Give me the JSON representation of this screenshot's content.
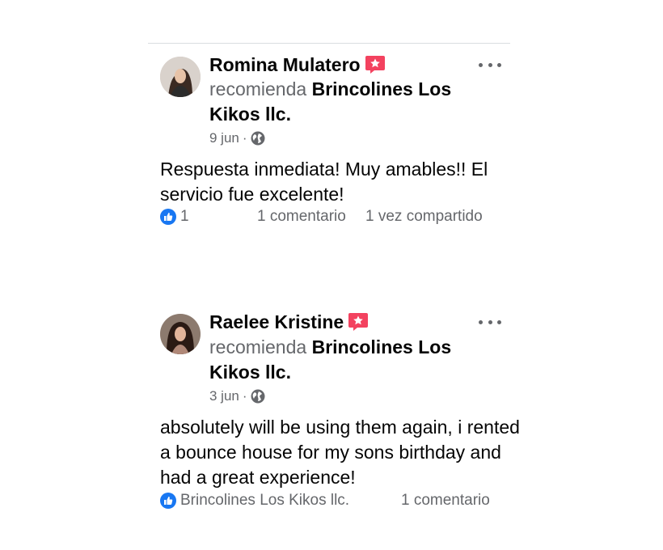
{
  "posts": [
    {
      "author": "Romina Mulatero",
      "verb": "recomienda",
      "page": "Brincolines Los Kikos llc.",
      "date": "9 jun",
      "separator": "·",
      "text": "Respuesta inmediata! Muy amables!! El servicio fue excelente!",
      "reactions": "1",
      "comments": "1 comentario",
      "shares": "1 vez compartido"
    },
    {
      "author": "Raelee Kristine",
      "verb": "recomienda",
      "page": "Brincolines Los Kikos llc.",
      "date": "3 jun",
      "separator": "·",
      "text": "absolutely will be using them again, i rented a bounce house for my sons birthday and had a great experience!",
      "reactions": "Brincolines Los Kikos llc.",
      "comments": "1 comentario"
    }
  ],
  "colors": {
    "recommend_badge": "#f3425f",
    "like_blue": "#1877f2",
    "secondary_text": "#65676b"
  },
  "icons": [
    "recommend-badge-icon",
    "globe-icon",
    "like-icon",
    "more-options-icon"
  ]
}
